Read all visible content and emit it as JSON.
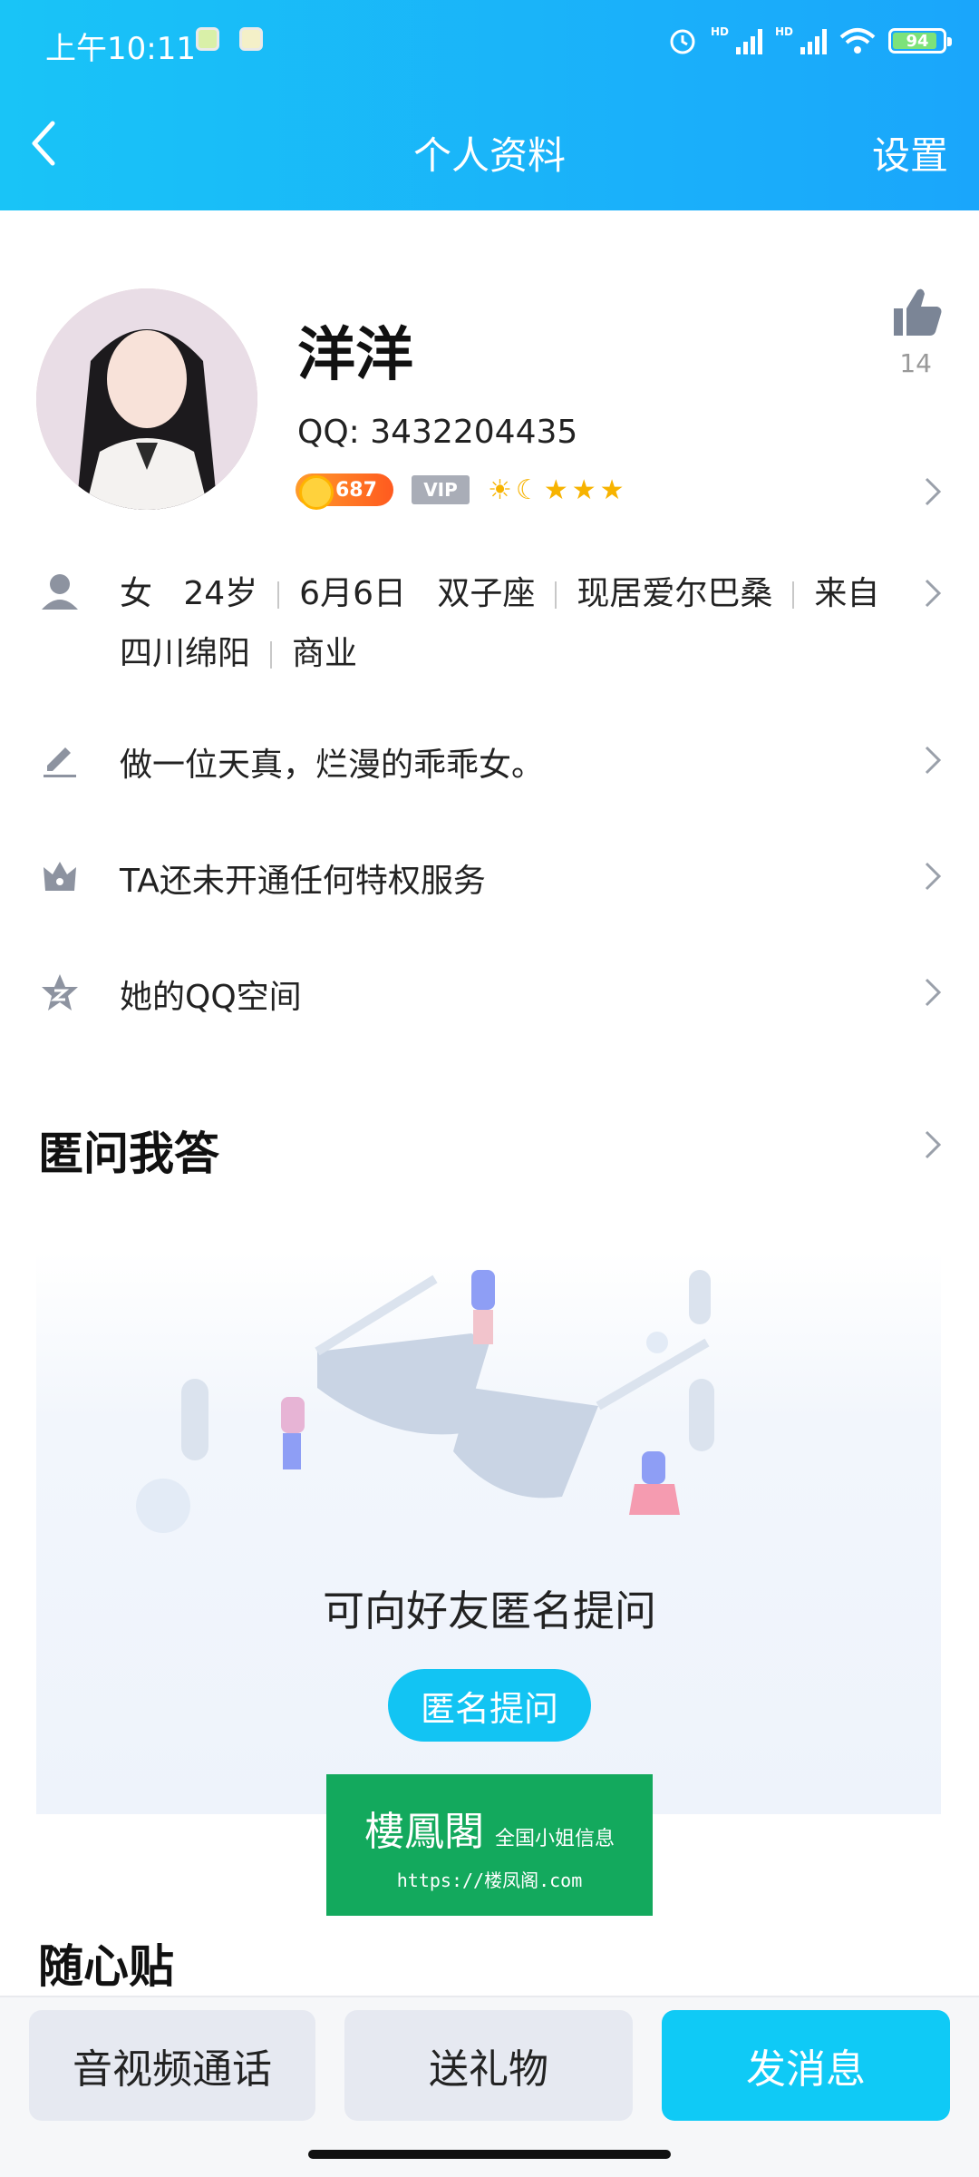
{
  "status_bar": {
    "time": "上午10:11",
    "battery": "94",
    "network_hd_1": "HD",
    "network_hd_2": "HD"
  },
  "nav": {
    "title": "个人资料",
    "settings_label": "设置",
    "back_icon": "chevron-left-icon"
  },
  "profile": {
    "name": "洋洋",
    "qq": "QQ: 3432204435",
    "likes": "14",
    "coin_value": "687",
    "vip_label": "VIP",
    "level_icons": [
      "sun-icon",
      "moon-icon",
      "star-icon",
      "star-icon",
      "star-icon"
    ]
  },
  "info": {
    "gender": "女",
    "age": "24岁",
    "birthday": "6月6日",
    "zodiac": "双子座",
    "residence": "现居爱尔巴桑",
    "origin_prefix": "来自",
    "origin_place": "四川绵阳",
    "occupation": "商业"
  },
  "rows": {
    "signature": "做一位天真，烂漫的乖乖女。",
    "privilege": "TA还未开通任何特权服务",
    "qzone": "她的QQ空间"
  },
  "anonymous": {
    "section_title": "匿问我答",
    "prompt": "可向好友匿名提问",
    "button": "匿名提问"
  },
  "watermark": {
    "brand": "樓鳳閣",
    "tagline": "全国小姐信息",
    "url": "https://楼凤阁.com"
  },
  "next_section_title": "随心贴",
  "actions": {
    "call": "音视频通话",
    "gift": "送礼物",
    "message": "发消息"
  },
  "colors": {
    "header_start": "#19c4f7",
    "header_end": "#1aa6fb",
    "primary_button": "#0fcaf6",
    "watermark_green": "#13a95d"
  }
}
